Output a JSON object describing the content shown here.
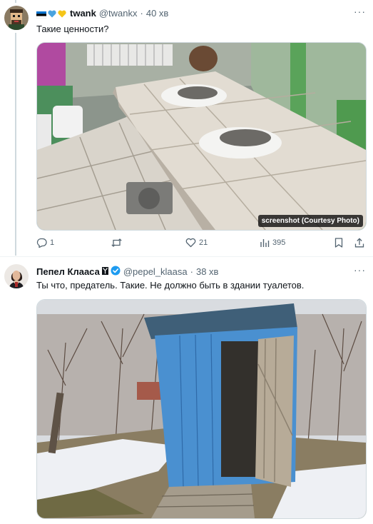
{
  "tweet1": {
    "display_name": "twank",
    "handle": "@twankx",
    "time": "40 хв",
    "text": "Такие ценности?",
    "media_caption": "screenshot (Courtesy Photo)",
    "stats": {
      "replies": "1",
      "retweets": "",
      "likes": "21",
      "views": "395"
    }
  },
  "tweet2": {
    "display_name": "Пепел Клааса",
    "handle": "@pepel_klaasa",
    "time": "38 хв",
    "text": "Ты что, предатель. Такие. Не должно быть в здании туалетов."
  },
  "colors": {
    "text": "#0f1419",
    "secondary": "#536471",
    "verified": "#1d9bf0",
    "border": "#cfd9de",
    "flag_blue": "#0072ce",
    "heart_blue": "#4aa3df",
    "heart_yellow": "#f5c518"
  },
  "icons": [
    "reply-icon",
    "retweet-icon",
    "like-icon",
    "views-icon",
    "bookmark-icon",
    "share-icon",
    "more-icon",
    "verified-icon"
  ]
}
